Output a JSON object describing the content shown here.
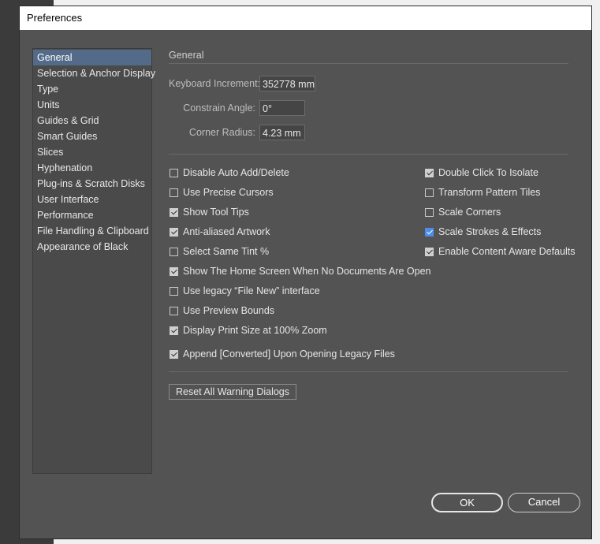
{
  "window": {
    "title": "Preferences"
  },
  "sidebar": {
    "items": [
      {
        "label": "General",
        "selected": true
      },
      {
        "label": "Selection & Anchor Display"
      },
      {
        "label": "Type"
      },
      {
        "label": "Units"
      },
      {
        "label": "Guides & Grid"
      },
      {
        "label": "Smart Guides"
      },
      {
        "label": "Slices"
      },
      {
        "label": "Hyphenation"
      },
      {
        "label": "Plug-ins & Scratch Disks"
      },
      {
        "label": "User Interface"
      },
      {
        "label": "Performance"
      },
      {
        "label": "File Handling & Clipboard"
      },
      {
        "label": "Appearance of Black"
      }
    ]
  },
  "general": {
    "section_title": "General",
    "keyboard_increment": {
      "label": "Keyboard Increment:",
      "value": "352778 mm"
    },
    "constrain_angle": {
      "label": "Constrain Angle:",
      "value": "0°"
    },
    "corner_radius": {
      "label": "Corner Radius:",
      "value": "4.23 mm"
    },
    "left_options": [
      {
        "label": "Disable Auto Add/Delete",
        "checked": false
      },
      {
        "label": "Use Precise Cursors",
        "checked": false
      },
      {
        "label": "Show Tool Tips",
        "checked": true
      },
      {
        "label": "Anti-aliased Artwork",
        "checked": true
      },
      {
        "label": "Select Same Tint %",
        "checked": false
      },
      {
        "label": "Show The Home Screen When No Documents Are Open",
        "checked": true
      },
      {
        "label": "Use legacy “File New” interface",
        "checked": false
      },
      {
        "label": "Use Preview Bounds",
        "checked": false
      },
      {
        "label": "Display Print Size at 100% Zoom",
        "checked": true
      },
      {
        "label": "Append [Converted] Upon Opening Legacy Files",
        "checked": true
      }
    ],
    "right_options": [
      {
        "label": "Double Click To Isolate",
        "checked": true
      },
      {
        "label": "Transform Pattern Tiles",
        "checked": false
      },
      {
        "label": "Scale Corners",
        "checked": false
      },
      {
        "label": "Scale Strokes & Effects",
        "checked": true,
        "accent": true
      },
      {
        "label": "Enable Content Aware Defaults",
        "checked": true
      }
    ],
    "reset_button": "Reset All Warning Dialogs"
  },
  "footer": {
    "ok_label": "OK",
    "cancel_label": "Cancel"
  },
  "colors": {
    "accent": "#4d8ee8",
    "selection": "#536b88",
    "panel": "#535353"
  }
}
